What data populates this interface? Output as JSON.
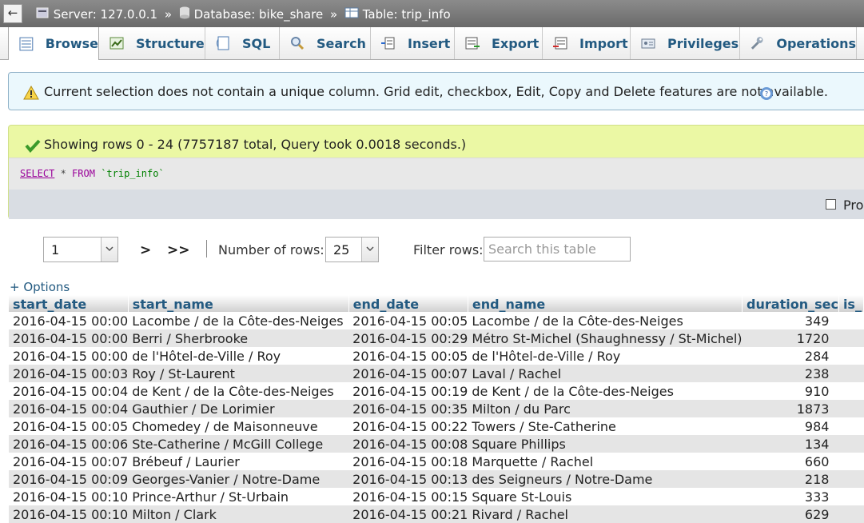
{
  "breadcrumb": {
    "back": "←",
    "server": "Server: 127.0.0.1",
    "database": "Database: bike_share",
    "table": "Table: trip_info",
    "separator": "»"
  },
  "tabs": [
    {
      "label": "Browse",
      "icon": "browse-icon",
      "active": true
    },
    {
      "label": "Structure",
      "icon": "structure-icon"
    },
    {
      "label": "SQL",
      "icon": "sql-icon"
    },
    {
      "label": "Search",
      "icon": "search-icon"
    },
    {
      "label": "Insert",
      "icon": "insert-icon"
    },
    {
      "label": "Export",
      "icon": "export-icon"
    },
    {
      "label": "Import",
      "icon": "import-icon"
    },
    {
      "label": "Privileges",
      "icon": "privileges-icon"
    },
    {
      "label": "Operations",
      "icon": "operations-icon"
    }
  ],
  "notice": {
    "text": "Current selection does not contain a unique column. Grid edit, checkbox, Edit, Copy and Delete features are not available."
  },
  "success": {
    "text": "Showing rows 0 - 24 (7757187 total, Query took 0.0018 seconds.)",
    "query_select": "SELECT",
    "query_rest": " * ",
    "query_from": "FROM",
    "query_table": "`trip_info`",
    "profiling_label": "Pro"
  },
  "nav": {
    "page_value": "1",
    "next": ">",
    "last": ">>",
    "rows_label": "Number of rows:",
    "rows_value": "25",
    "filter_label": "Filter rows:",
    "filter_placeholder": "Search this table",
    "options_link": "+ Options"
  },
  "columns": [
    "start_date",
    "start_name",
    "end_date",
    "end_name",
    "duration_sec",
    "is_"
  ],
  "rows": [
    [
      "2016-04-15 00:00",
      "Lacombe / de la Côte-des-Neiges",
      "2016-04-15 00:05",
      "Lacombe / de la Côte-des-Neiges",
      "349"
    ],
    [
      "2016-04-15 00:00",
      "Berri / Sherbrooke",
      "2016-04-15 00:29",
      "Métro St-Michel (Shaughnessy / St-Michel)",
      "1720"
    ],
    [
      "2016-04-15 00:00",
      "de l'Hôtel-de-Ville / Roy",
      "2016-04-15 00:05",
      "de l'Hôtel-de-Ville / Roy",
      "284"
    ],
    [
      "2016-04-15 00:03",
      "Roy / St-Laurent",
      "2016-04-15 00:07",
      "Laval / Rachel",
      "238"
    ],
    [
      "2016-04-15 00:04",
      "de Kent / de la Côte-des-Neiges",
      "2016-04-15 00:19",
      "de Kent / de la Côte-des-Neiges",
      "910"
    ],
    [
      "2016-04-15 00:04",
      "Gauthier / De Lorimier",
      "2016-04-15 00:35",
      "Milton / du Parc",
      "1873"
    ],
    [
      "2016-04-15 00:05",
      "Chomedey / de Maisonneuve",
      "2016-04-15 00:22",
      "Towers / Ste-Catherine",
      "984"
    ],
    [
      "2016-04-15 00:06",
      "Ste-Catherine / McGill College",
      "2016-04-15 00:08",
      "Square Phillips",
      "134"
    ],
    [
      "2016-04-15 00:07",
      "Brébeuf / Laurier",
      "2016-04-15 00:18",
      "Marquette / Rachel",
      "660"
    ],
    [
      "2016-04-15 00:09",
      "Georges-Vanier / Notre-Dame",
      "2016-04-15 00:13",
      "des Seigneurs / Notre-Dame",
      "218"
    ],
    [
      "2016-04-15 00:10",
      "Prince-Arthur / St-Urbain",
      "2016-04-15 00:15",
      "Square St-Louis",
      "333"
    ],
    [
      "2016-04-15 00:10",
      "Milton / Clark",
      "2016-04-15 00:21",
      "Rivard / Rachel",
      "629"
    ]
  ]
}
